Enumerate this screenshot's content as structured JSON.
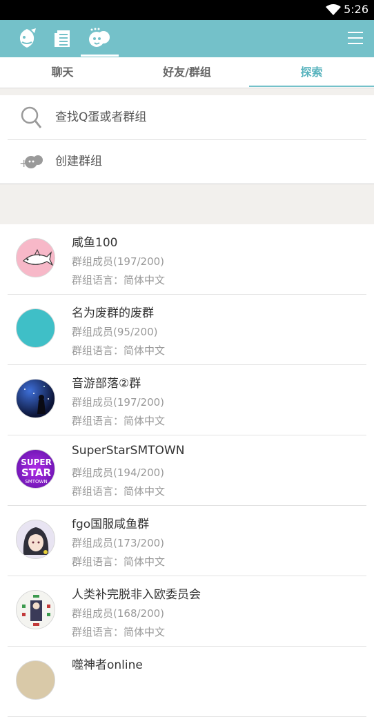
{
  "statusbar": {
    "time": "5:26",
    "wifi_icon": "wifi-icon"
  },
  "appbar": {
    "color": "#74c1c9",
    "tabs": [
      {
        "icon": "chat-fish-icon"
      },
      {
        "icon": "notes-icon"
      },
      {
        "icon": "explore-face-icon",
        "active": true
      }
    ],
    "menu_icon": "menu-icon"
  },
  "subtabs": [
    {
      "label": "聊天"
    },
    {
      "label": "好友/群组"
    },
    {
      "label": "探索",
      "active": true
    }
  ],
  "actions": {
    "search_label": "查找Q蛋或者群组",
    "create_label": "创建群组"
  },
  "groups": [
    {
      "name": "咸鱼100",
      "members": "群组成员(197/200)",
      "lang": "群组语言：简体中文",
      "avatar_color": "#f7b8c8",
      "avatar_icon": "fish-avatar"
    },
    {
      "name": "名为废群的废群",
      "members": "群组成员(95/200)",
      "lang": "群组语言：简体中文",
      "avatar_color": "#3fbfc7",
      "avatar_icon": "plain-teal-avatar"
    },
    {
      "name": "音游部落②群",
      "members": "群组成员(197/200)",
      "lang": "群组语言：简体中文",
      "avatar_color": "#1b2a6b",
      "avatar_icon": "night-sky-avatar"
    },
    {
      "name": "SuperStarSMTOWN",
      "members": "群组成员(194/200)",
      "lang": "群组语言：简体中文",
      "avatar_color": "#7a1fc4",
      "avatar_icon": "superstar-logo-avatar"
    },
    {
      "name": "fgo国服咸鱼群",
      "members": "群组成员(173/200)",
      "lang": "群组语言：简体中文",
      "avatar_color": "#2f2f3a",
      "avatar_icon": "anime-girl-avatar"
    },
    {
      "name": "人类补完脱非入欧委员会",
      "members": "群组成员(168/200)",
      "lang": "群组语言：简体中文",
      "avatar_color": "#f4f4f0",
      "avatar_icon": "card-art-avatar"
    },
    {
      "name": "噬神者online",
      "members": "",
      "lang": "",
      "avatar_color": "#d9c9a8",
      "avatar_icon": "partial-avatar"
    }
  ]
}
